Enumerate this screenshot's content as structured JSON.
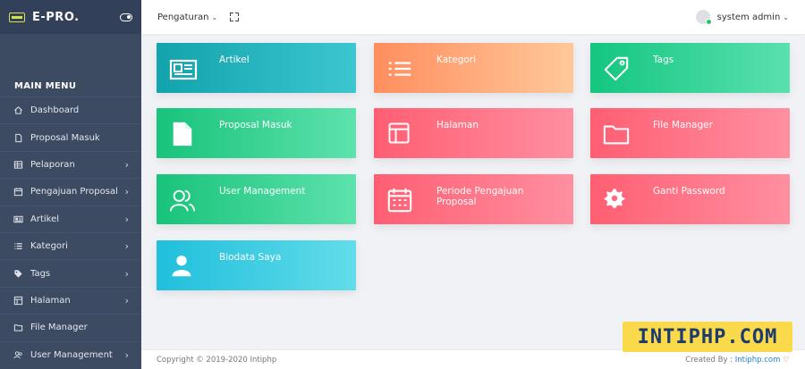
{
  "brand": {
    "name": "E-PRO."
  },
  "sidebar": {
    "header": "MAIN MENU",
    "items": [
      {
        "label": "Dashboard",
        "icon": "home-icon",
        "chevron": false
      },
      {
        "label": "Proposal Masuk",
        "icon": "file-icon",
        "chevron": false
      },
      {
        "label": "Pelaporan",
        "icon": "table-icon",
        "chevron": true
      },
      {
        "label": "Pengajuan Proposal",
        "icon": "calendar-icon",
        "chevron": true
      },
      {
        "label": "Artikel",
        "icon": "newspaper-icon",
        "chevron": true
      },
      {
        "label": "Kategori",
        "icon": "list-icon",
        "chevron": true
      },
      {
        "label": "Tags",
        "icon": "tags-icon",
        "chevron": true
      },
      {
        "label": "Halaman",
        "icon": "layout-icon",
        "chevron": true
      },
      {
        "label": "File Manager",
        "icon": "folder-icon",
        "chevron": false
      },
      {
        "label": "User Management",
        "icon": "users-icon",
        "chevron": true
      }
    ]
  },
  "topbar": {
    "menu_label": "Pengaturan",
    "user_name": "system admin"
  },
  "cards": [
    {
      "label": "Artikel",
      "icon": "newspaper-icon",
      "colors": [
        "#12a3ad",
        "#3cc6d0"
      ]
    },
    {
      "label": "Kategori",
      "icon": "list-icon",
      "colors": [
        "#ff8e5e",
        "#ffc89a"
      ]
    },
    {
      "label": "Tags",
      "icon": "tag-icon",
      "colors": [
        "#13c67f",
        "#5be0b0"
      ]
    },
    {
      "label": "Proposal Masuk",
      "icon": "file-icon",
      "colors": [
        "#18c37b",
        "#5ee2ad"
      ]
    },
    {
      "label": "Halaman",
      "icon": "layout-icon",
      "colors": [
        "#ff5e72",
        "#ff8fa0"
      ]
    },
    {
      "label": "File Manager",
      "icon": "folder-icon",
      "colors": [
        "#ff5e72",
        "#ff8fa0"
      ]
    },
    {
      "label": "User Management",
      "icon": "users-icon",
      "colors": [
        "#18c37b",
        "#5ee2ad"
      ]
    },
    {
      "label": "Periode Pengajuan Proposal",
      "icon": "calendar-icon",
      "colors": [
        "#ff5e72",
        "#ff8fa0"
      ]
    },
    {
      "label": "Ganti Password",
      "icon": "gear-icon",
      "colors": [
        "#ff5e72",
        "#ff8fa0"
      ]
    },
    {
      "label": "Biodata Saya",
      "icon": "user-icon",
      "colors": [
        "#20bfdc",
        "#62dcea"
      ]
    }
  ],
  "footer": {
    "copyright": "Copyright © 2019-2020 Intiphp",
    "created_by": "Created By :",
    "created_link": "Intiphp.com"
  },
  "watermark": "INTIPHP.COM"
}
